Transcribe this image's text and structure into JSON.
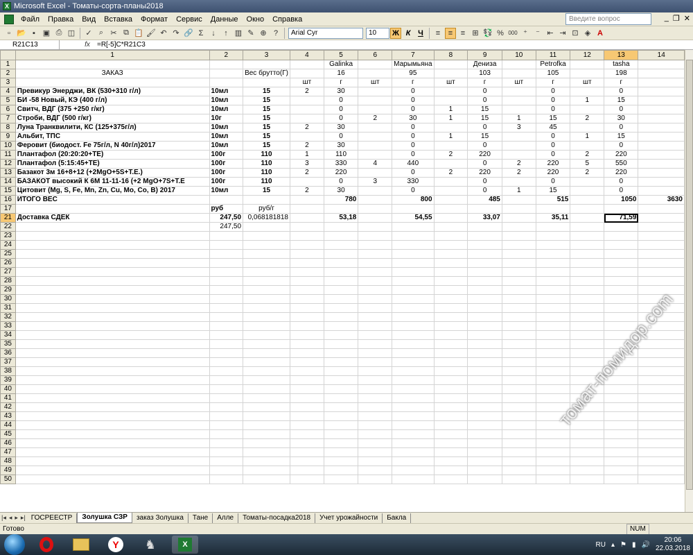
{
  "window": {
    "title": "Microsoft Excel - Томаты-сорта-планы2018"
  },
  "menu": [
    "Файл",
    "Правка",
    "Вид",
    "Вставка",
    "Формат",
    "Сервис",
    "Данные",
    "Окно",
    "Справка"
  ],
  "help_placeholder": "Введите вопрос",
  "toolbar": {
    "font_name": "Arial Cyr",
    "font_size": "10",
    "bold": "Ж",
    "italic": "К",
    "underline": "Ч",
    "sigma": "Σ",
    "percent": "%",
    "thousands": "000"
  },
  "formula_bar": {
    "cell_ref": "R21C13",
    "fx": "fx",
    "formula": "=R[-5]C*R21C3"
  },
  "columns": [
    "",
    "1",
    "2",
    "3",
    "4",
    "5",
    "6",
    "7",
    "8",
    "9",
    "10",
    "11",
    "12",
    "13",
    "14"
  ],
  "rows": [
    {
      "n": "1",
      "c": [
        "",
        "",
        "",
        "",
        "Galinka",
        "",
        "Марымьяна",
        "",
        "Дениза",
        "",
        "Petrofka",
        "",
        "tasha",
        ""
      ]
    },
    {
      "n": "2",
      "c": [
        "ЗАКАЗ",
        "",
        "Вес брутто(Г)",
        "",
        "16",
        "",
        "95",
        "",
        "103",
        "",
        "105",
        "",
        "198",
        ""
      ]
    },
    {
      "n": "3",
      "c": [
        "",
        "",
        "",
        "шт",
        "г",
        "шт",
        "г",
        "шт",
        "г",
        "шт",
        "г",
        "шт",
        "г",
        ""
      ]
    },
    {
      "n": "4",
      "c": [
        "Превикур Энерджи, ВК (530+310 г/л)",
        "10мл",
        "15",
        "2",
        "30",
        "",
        "0",
        "",
        "0",
        "",
        "0",
        "",
        "0",
        ""
      ]
    },
    {
      "n": "5",
      "c": [
        "БИ -58 Новый, КЭ (400 г/л)",
        "10мл",
        "15",
        "",
        "0",
        "",
        "0",
        "",
        "0",
        "",
        "0",
        "1",
        "15",
        ""
      ]
    },
    {
      "n": "6",
      "c": [
        "Свитч, ВДГ (375 +250 г/кг)",
        "10мл",
        "15",
        "",
        "0",
        "",
        "0",
        "1",
        "15",
        "",
        "0",
        "",
        "0",
        ""
      ]
    },
    {
      "n": "7",
      "c": [
        "Строби, ВДГ (500 г/кг)",
        "10г",
        "15",
        "",
        "0",
        "2",
        "30",
        "1",
        "15",
        "1",
        "15",
        "2",
        "30",
        ""
      ]
    },
    {
      "n": "8",
      "c": [
        "Луна Транквилити, КС (125+375г/л)",
        "10мл",
        "15",
        "2",
        "30",
        "",
        "0",
        "",
        "0",
        "3",
        "45",
        "",
        "0",
        ""
      ]
    },
    {
      "n": "9",
      "c": [
        "Альбит, ТПС",
        "10мл",
        "15",
        "",
        "0",
        "",
        "0",
        "1",
        "15",
        "",
        "0",
        "1",
        "15",
        ""
      ]
    },
    {
      "n": "10",
      "c": [
        "Феровит (биодост. Fe 75г/л, N 40г/л)2017",
        "10мл",
        "15",
        "2",
        "30",
        "",
        "0",
        "",
        "0",
        "",
        "0",
        "",
        "0",
        ""
      ]
    },
    {
      "n": "11",
      "c": [
        "Плантафол (20:20:20+ТЕ)",
        "100г",
        "110",
        "1",
        "110",
        "",
        "0",
        "2",
        "220",
        "",
        "0",
        "2",
        "220",
        ""
      ]
    },
    {
      "n": "12",
      "c": [
        "Плантафол (5:15:45+ТЕ)",
        "100г",
        "110",
        "3",
        "330",
        "4",
        "440",
        "",
        "0",
        "2",
        "220",
        "5",
        "550",
        ""
      ]
    },
    {
      "n": "13",
      "c": [
        "Базакот 3м 16+8+12 (+2MgO+5S+T.E.)",
        "100г",
        "110",
        "2",
        "220",
        "",
        "0",
        "2",
        "220",
        "2",
        "220",
        "2",
        "220",
        ""
      ]
    },
    {
      "n": "14",
      "c": [
        "БАЗАКОТ высокий К 6М 11-11-16 (+2 MgO+7S+T.E",
        "100г",
        "110",
        "",
        "0",
        "3",
        "330",
        "",
        "0",
        "",
        "0",
        "",
        "0",
        ""
      ]
    },
    {
      "n": "15",
      "c": [
        "Цитовит (Mg, S, Fe, Mn, Zn, Cu, Mo, Co, B) 2017",
        "10мл",
        "15",
        "2",
        "30",
        "",
        "0",
        "",
        "0",
        "1",
        "15",
        "",
        "0",
        ""
      ]
    },
    {
      "n": "16",
      "c": [
        "ИТОГО ВЕС",
        "",
        "",
        "",
        "780",
        "",
        "800",
        "",
        "485",
        "",
        "515",
        "",
        "1050",
        "3630"
      ]
    },
    {
      "n": "17",
      "c": [
        "",
        "руб",
        "руб/г",
        "",
        "",
        "",
        "",
        "",
        "",
        "",
        "",
        "",
        "",
        ""
      ]
    },
    {
      "n": "21",
      "c": [
        "Доставка СДЕК",
        "247,50",
        "0,068181818",
        "",
        "53,18",
        "",
        "54,55",
        "",
        "33,07",
        "",
        "35,11",
        "",
        "71,59",
        ""
      ]
    },
    {
      "n": "22",
      "c": [
        "",
        "247,50",
        "",
        "",
        "",
        "",
        "",
        "",
        "",
        "",
        "",
        "",
        "",
        ""
      ]
    }
  ],
  "empty_rows": [
    "23",
    "24",
    "25",
    "26",
    "27",
    "28",
    "29",
    "30",
    "31",
    "32",
    "33",
    "34",
    "35",
    "36",
    "37",
    "38",
    "39",
    "40",
    "41",
    "42",
    "43",
    "44",
    "45",
    "46",
    "47",
    "48",
    "49",
    "50"
  ],
  "sheet_tabs": [
    "ГОСРЕЕСТР",
    "Золушка СЗР",
    "заказ Золушка",
    "Тане",
    "Алле",
    "Томаты-посадка2018",
    "Учет урожайности",
    "Бакла"
  ],
  "active_tab": "Золушка СЗР",
  "status": {
    "ready": "Готово",
    "num": "NUM"
  },
  "tray": {
    "lang": "RU",
    "time": "20:06",
    "date": "22.03.2018"
  },
  "watermark": "томат-помидор.com"
}
